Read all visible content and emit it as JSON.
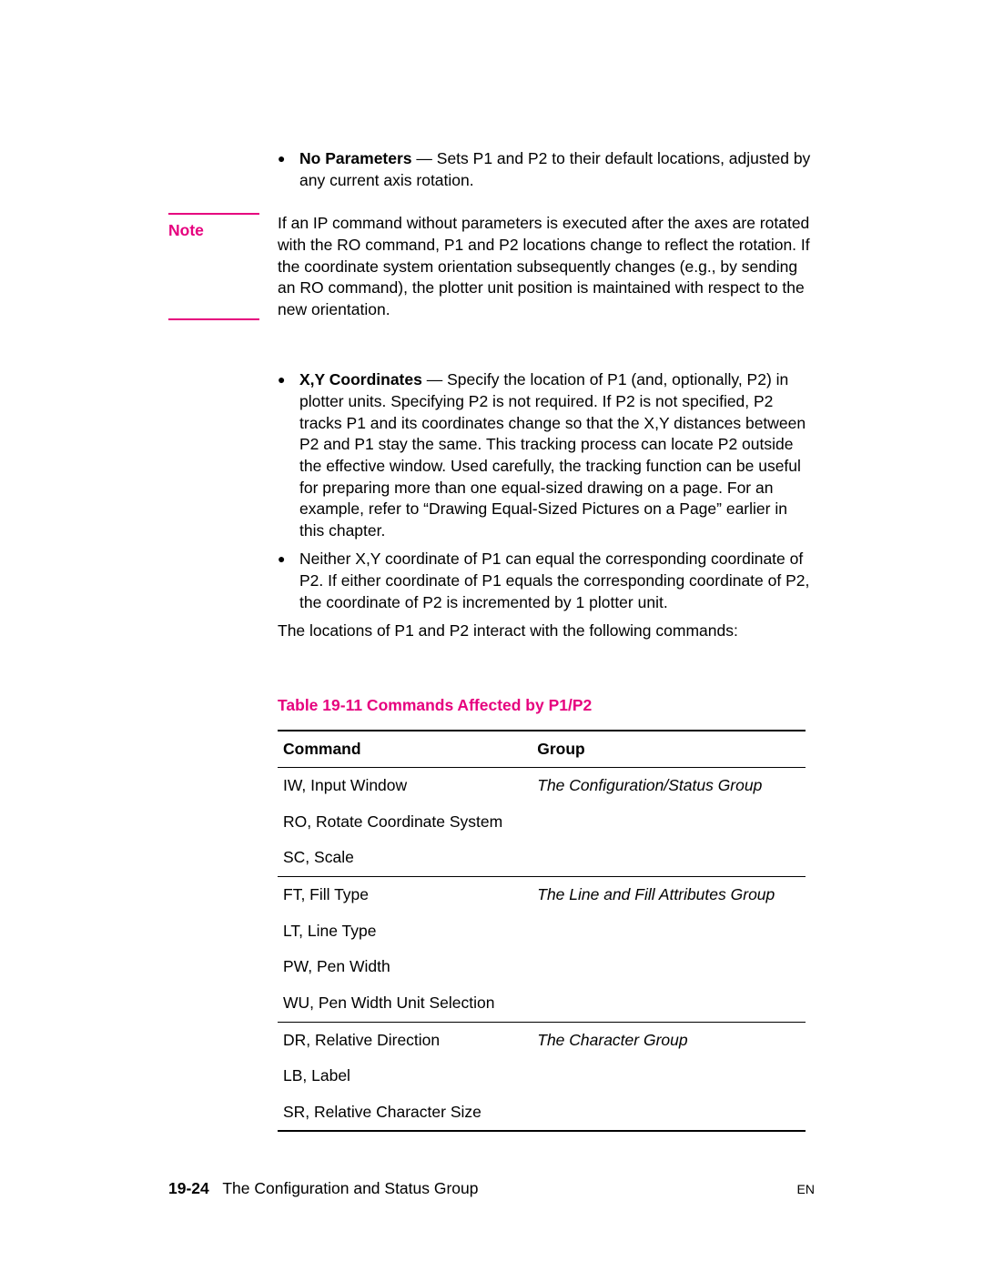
{
  "bullets": {
    "noParams": {
      "label": "No Parameters",
      "text": " — Sets P1 and P2 to their default locations, adjusted by any current axis rotation."
    },
    "xy": {
      "label": "X,Y Coordinates",
      "text": " — Specify the location of P1 (and, optionally, P2) in plotter units. Specifying P2 is not required. If P2 is not specified, P2 tracks P1 and its coordinates change so that the X,Y distances between P2 and P1 stay the same. This tracking process can locate P2 outside the effective window. Used carefully, the tracking function can be useful for preparing more than one equal-sized drawing on a page. For an example, refer to “Drawing Equal-Sized Pictures on a Page” earlier in this chapter."
    },
    "neither": "Neither X,Y coordinate of P1 can equal the corresponding coordinate of P2. If either coordinate of P1 equals the corres­ponding coordinate of P2, the coordinate of P2 is incremented by 1 plotter unit."
  },
  "note": {
    "label": "Note",
    "body": "If an IP command without parameters is executed after the axes are rotated with the RO command, P1 and P2 locations change to reflect the rotation. If the coordinate system orientation subsequently changes (e.g., by sending an RO command), the plotter unit position is maintained with respect to the new orientation."
  },
  "afterBullets": "The locations of P1 and P2 interact with the following commands:",
  "table": {
    "caption": "Table 19-11  Commands Affected by P1/P2",
    "headers": {
      "command": "Command",
      "group": "Group"
    },
    "groups": [
      {
        "group": "The Configuration/Status Group",
        "rows": [
          "IW, Input Window",
          "RO, Rotate Coordinate System",
          "SC, Scale"
        ]
      },
      {
        "group": "The Line and Fill Attributes Group",
        "rows": [
          "FT, Fill Type",
          "LT, Line Type",
          "PW, Pen Width",
          "WU, Pen Width Unit Selection"
        ]
      },
      {
        "group": "The Character Group",
        "rows": [
          "DR, Relative Direction",
          "LB, Label",
          "SR, Relative Character Size"
        ]
      }
    ]
  },
  "footer": {
    "pagenum": "19-24",
    "chapter": "The Configuration and Status Group",
    "lang": "EN"
  }
}
